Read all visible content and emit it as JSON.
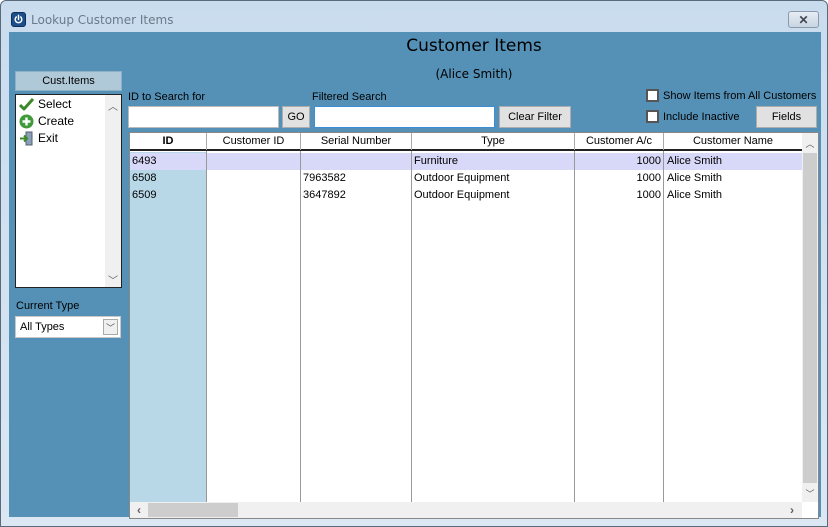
{
  "window": {
    "title": "Lookup Customer Items",
    "close_icon": "close-icon"
  },
  "header": {
    "title": "Customer Items",
    "subtitle": "(Alice Smith)"
  },
  "left_panel": {
    "title": "Cust.Items",
    "actions": [
      {
        "label": "Select",
        "icon": "checkmark-icon"
      },
      {
        "label": "Create",
        "icon": "plus-circle-icon"
      },
      {
        "label": "Exit",
        "icon": "exit-door-icon"
      }
    ],
    "current_type_label": "Current Type",
    "current_type_value": "All Types"
  },
  "search": {
    "id_label": "ID to Search for",
    "id_value": "",
    "go_label": "GO",
    "filter_label": "Filtered Search",
    "filter_value": "",
    "clear_label": "Clear Filter",
    "show_all_label": "Show Items from All Customers",
    "show_all_checked": false,
    "include_inactive_label": "Include Inactive",
    "include_inactive_checked": false,
    "fields_label": "Fields"
  },
  "grid": {
    "columns": [
      "ID",
      "Customer ID",
      "Serial Number",
      "Type",
      "Customer A/c",
      "Customer Name"
    ],
    "rows": [
      {
        "id": "6493",
        "customer_id": "",
        "serial": "",
        "type": "Furniture",
        "account": "1000",
        "name": "Alice Smith",
        "selected": true
      },
      {
        "id": "6508",
        "customer_id": "",
        "serial": "7963582",
        "type": "Outdoor Equipment",
        "account": "1000",
        "name": "Alice Smith",
        "selected": false
      },
      {
        "id": "6509",
        "customer_id": "",
        "serial": "3647892",
        "type": "Outdoor Equipment",
        "account": "1000",
        "name": "Alice Smith",
        "selected": false
      }
    ]
  },
  "colors": {
    "client_bg": "#5591b6",
    "selected_row": "#d8d8f8",
    "id_column": "#b8d8e8"
  }
}
